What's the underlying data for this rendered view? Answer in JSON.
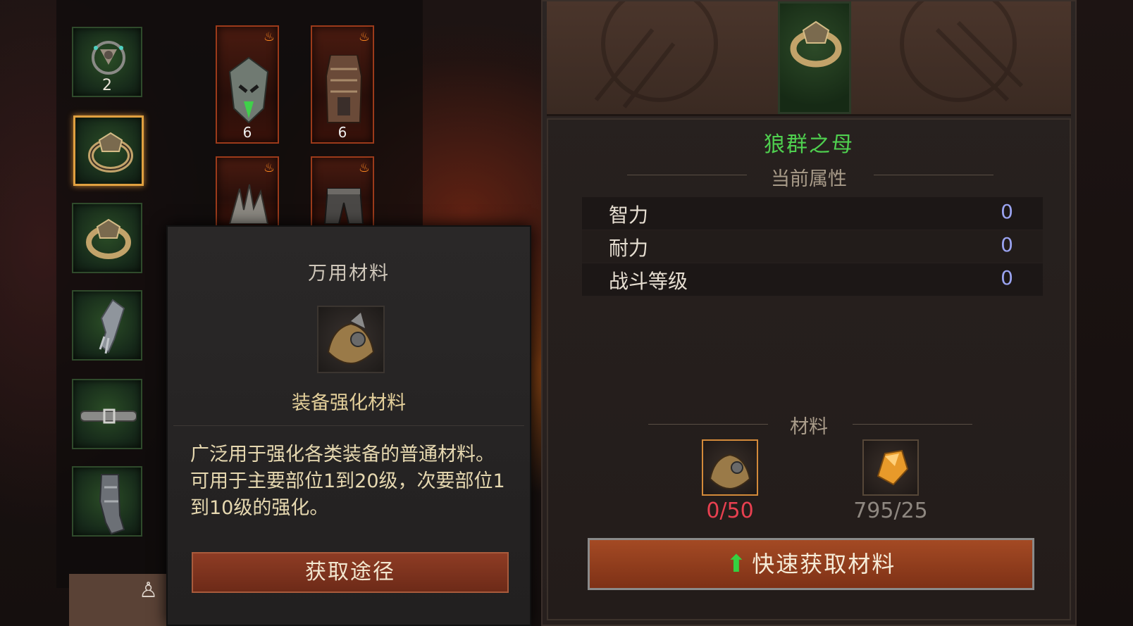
{
  "colors": {
    "hero_name": "#4fd04f",
    "stat_value": "#9aa3f0",
    "deficit": "#e84050",
    "sufficient": "#8e8780",
    "accent_frame": "#e0a040"
  },
  "left_slots": [
    {
      "icon": "amulet-icon",
      "count": "2",
      "selected": false
    },
    {
      "icon": "ring-icon",
      "count": "",
      "selected": true
    },
    {
      "icon": "ring-icon",
      "count": "",
      "selected": false
    },
    {
      "icon": "gauntlet-icon",
      "count": "",
      "selected": false
    },
    {
      "icon": "belt-icon",
      "count": "",
      "selected": false
    },
    {
      "icon": "boots-icon",
      "count": "",
      "selected": false
    }
  ],
  "equipment_cards": [
    {
      "icon": "helmet-icon",
      "count": "6"
    },
    {
      "icon": "chest-armor-icon",
      "count": "6"
    },
    {
      "icon": "shoulder-icon",
      "count": ""
    },
    {
      "icon": "pants-icon",
      "count": ""
    }
  ],
  "popup": {
    "title": "万用材料",
    "item_icon": "material-armor-icon",
    "item_name": "装备强化材料",
    "description": "广泛用于强化各类装备的普通材料。可用于主要部位1到20级，次要部位1到10级的强化。",
    "button": "获取途径"
  },
  "panel": {
    "header_icon": "ring-icon",
    "hero_name": "狼群之母",
    "attributes_heading": "当前属性",
    "stats": [
      {
        "label": "智力",
        "value": "0"
      },
      {
        "label": "耐力",
        "value": "0"
      },
      {
        "label": "战斗等级",
        "value": "0"
      }
    ],
    "materials_heading": "材料",
    "materials": [
      {
        "icon": "material-armor-icon",
        "count": "0/50",
        "status": "deficit"
      },
      {
        "icon": "amber-gem-icon",
        "count": "795/25",
        "status": "sufficient"
      }
    ],
    "quick_button": "快速获取材料",
    "quick_button_icon": "up-arrow-icon"
  },
  "bottom_figure_icon": "character-figure-icon"
}
